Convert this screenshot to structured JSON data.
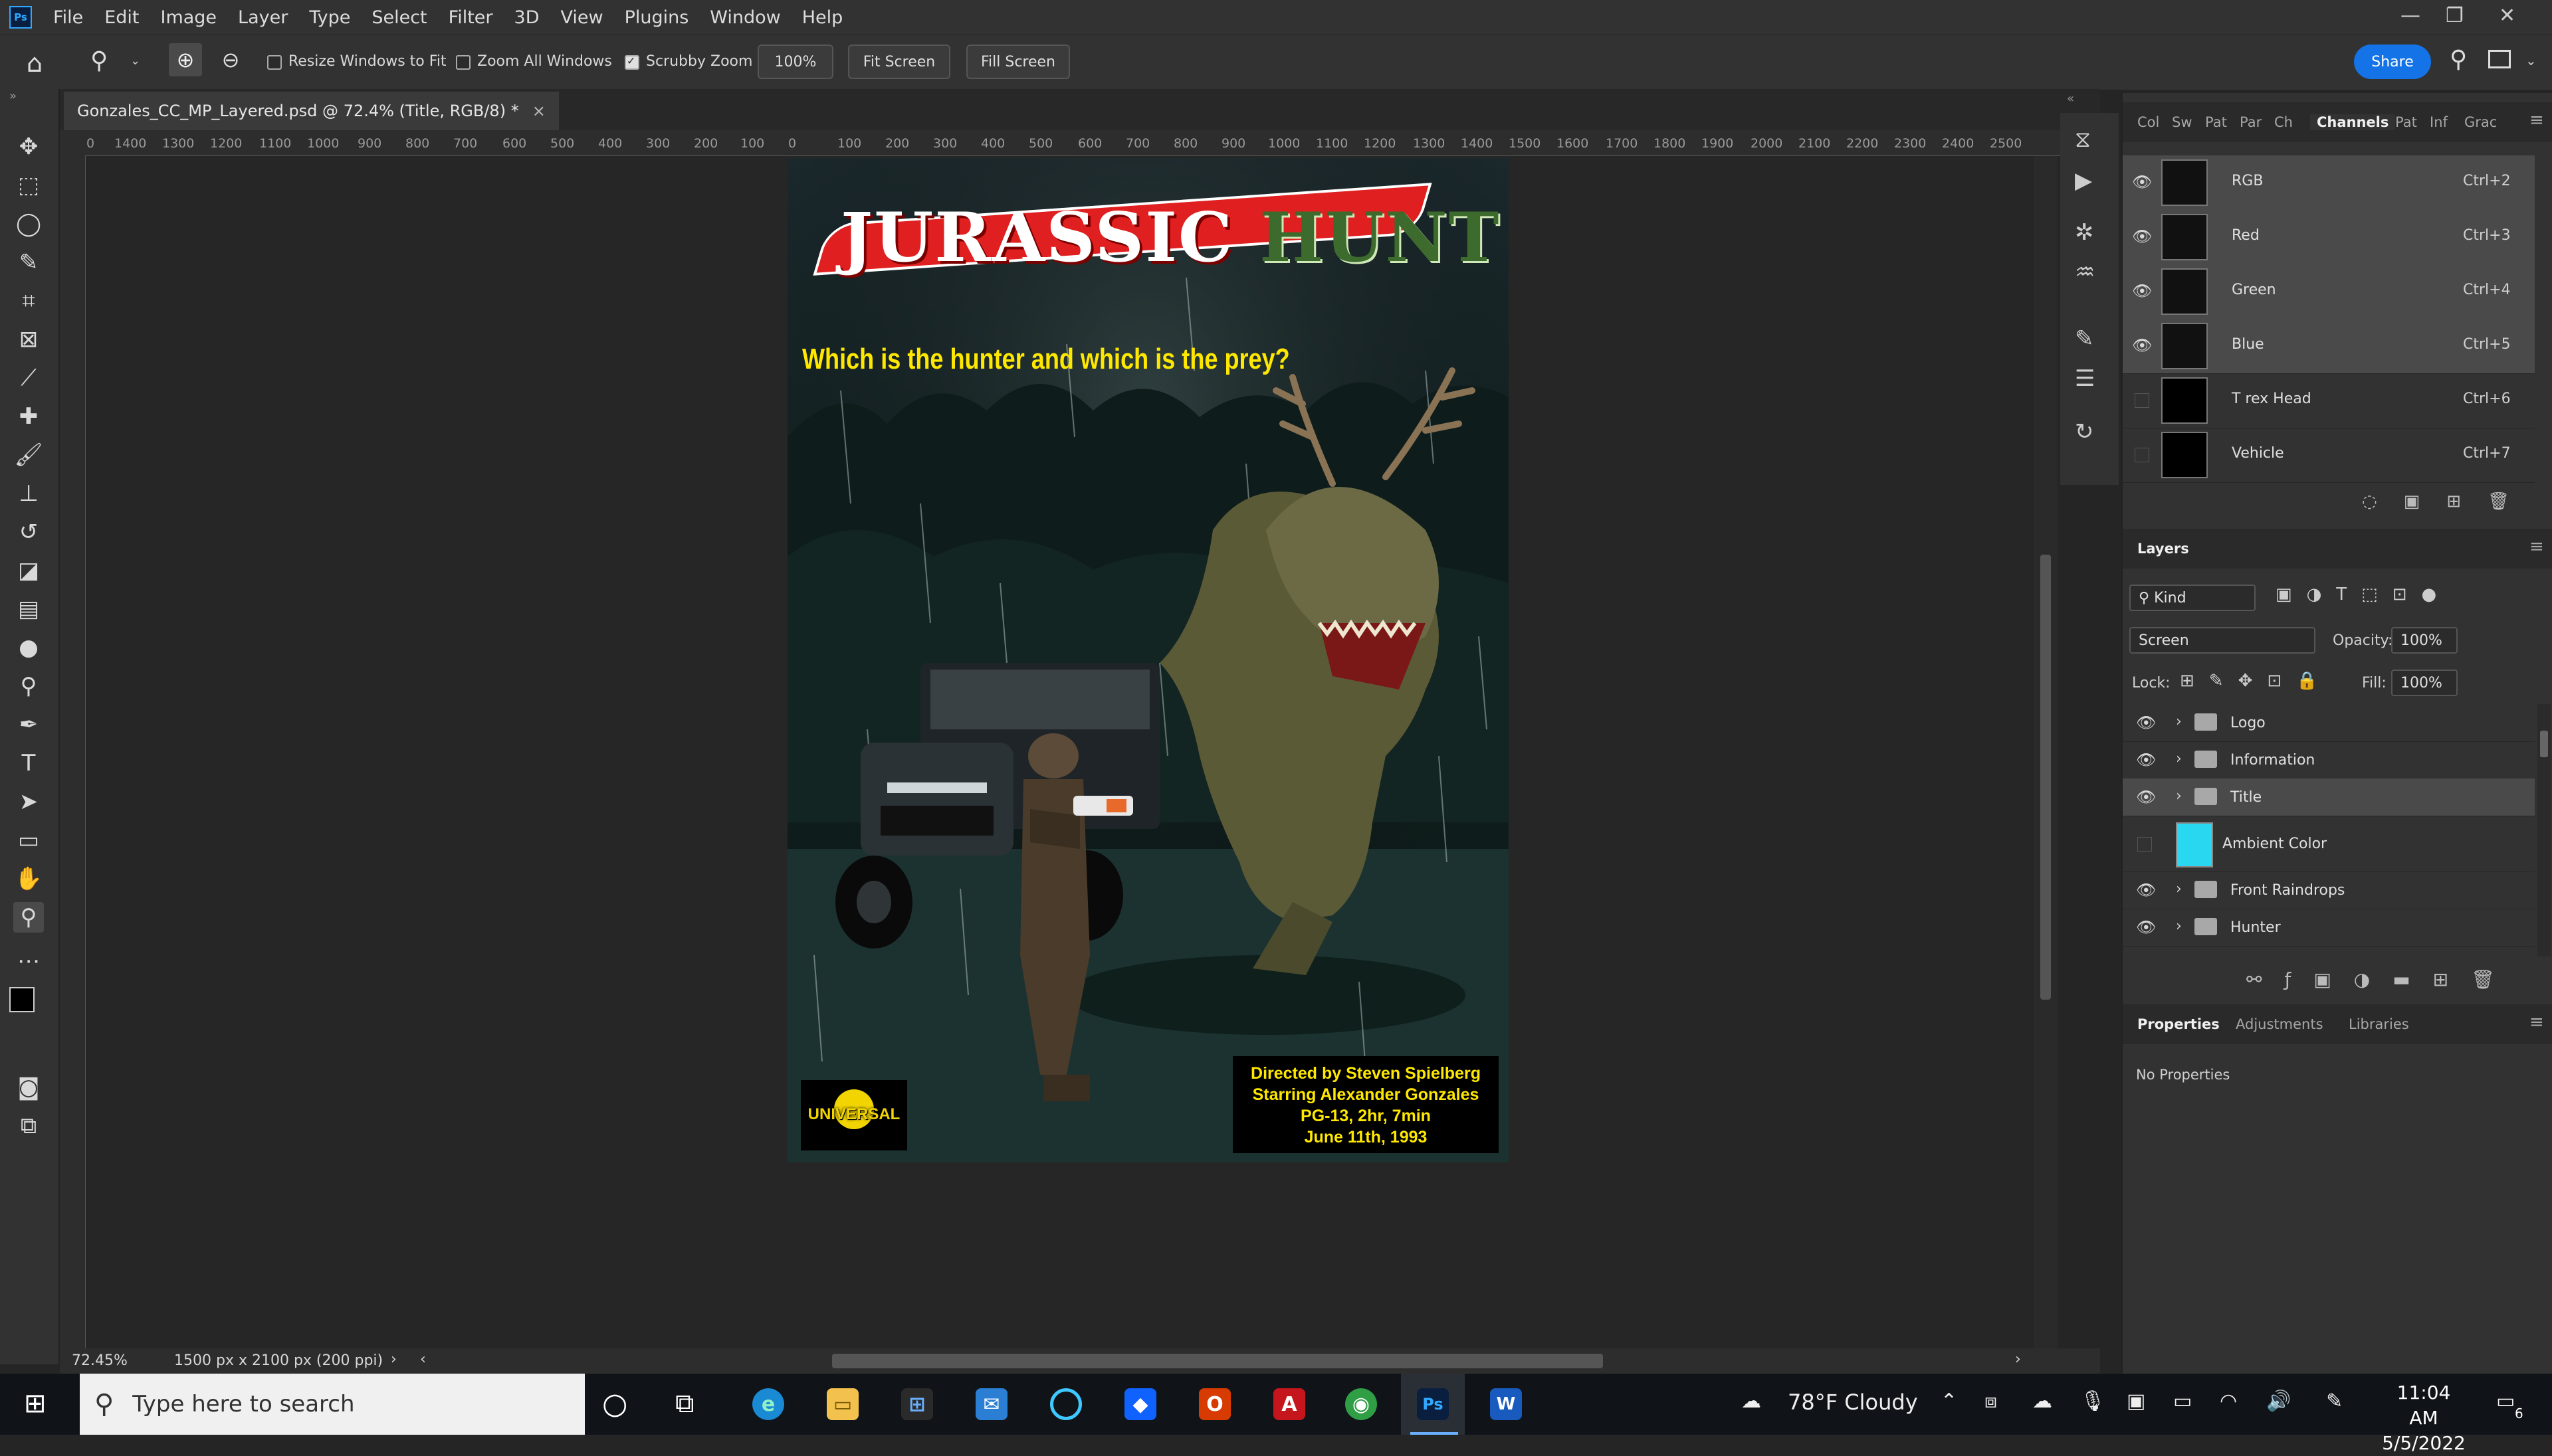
{
  "app": {
    "menu": [
      "File",
      "Edit",
      "Image",
      "Layer",
      "Type",
      "Select",
      "Filter",
      "3D",
      "View",
      "Plugins",
      "Window",
      "Help"
    ],
    "share_label": "Share"
  },
  "options": {
    "resize_windows": "Resize Windows to Fit",
    "zoom_all": "Zoom All Windows",
    "scrubby_zoom": "Scrubby Zoom",
    "zoom_value": "100%",
    "fit_screen": "Fit Screen",
    "fill_screen": "Fill Screen"
  },
  "document": {
    "tab_title": "Gonzales_CC_MP_Layered.psd @ 72.4% (Title, RGB/8) *",
    "ruler_marks": [
      "0",
      "1400",
      "1300",
      "1200",
      "1100",
      "1000",
      "900",
      "800",
      "700",
      "600",
      "500",
      "400",
      "300",
      "200",
      "100",
      "0",
      "100",
      "200",
      "300",
      "400",
      "500",
      "600",
      "700",
      "800",
      "900",
      "1000",
      "1100",
      "1200",
      "1300",
      "1400",
      "1500",
      "1600",
      "1700",
      "1800",
      "1900",
      "2000",
      "2100",
      "2200",
      "2300",
      "2400",
      "2500"
    ],
    "zoom": "72.45%",
    "dimensions": "1500 px x 2100 px (200 ppi)"
  },
  "poster": {
    "title_part1": "JURASSIC",
    "title_part2": "HUNT",
    "tagline": "Which is the hunter and which is the prey?",
    "studio": "UNIVERSAL",
    "credits": [
      "Directed by Steven Spielberg",
      "Starring Alexander Gonzales",
      "PG-13, 2hr, 7min",
      "June 11th, 1993"
    ]
  },
  "channels_panel": {
    "tabs": [
      "Col",
      "Sw",
      "Pat",
      "Par",
      "Ch",
      "Channels",
      "Pat",
      "Inf",
      "Grac"
    ],
    "rows": [
      {
        "name": "RGB",
        "shortcut": "Ctrl+2"
      },
      {
        "name": "Red",
        "shortcut": "Ctrl+3"
      },
      {
        "name": "Green",
        "shortcut": "Ctrl+4"
      },
      {
        "name": "Blue",
        "shortcut": "Ctrl+5"
      },
      {
        "name": "T rex Head",
        "shortcut": "Ctrl+6"
      },
      {
        "name": "Vehicle",
        "shortcut": "Ctrl+7"
      }
    ]
  },
  "layers_panel": {
    "title": "Layers",
    "filter_kind": "Kind",
    "blend_mode": "Screen",
    "opacity_label": "Opacity:",
    "opacity": "100%",
    "lock_label": "Lock:",
    "fill_label": "Fill:",
    "fill": "100%",
    "layers": [
      {
        "name": "Logo",
        "type": "group"
      },
      {
        "name": "Information",
        "type": "group"
      },
      {
        "name": "Title",
        "type": "group"
      },
      {
        "name": "Ambient Color",
        "type": "fill"
      },
      {
        "name": "Front Raindrops",
        "type": "group"
      },
      {
        "name": "Hunter",
        "type": "group"
      }
    ]
  },
  "properties_panel": {
    "tabs": [
      "Properties",
      "Adjustments",
      "Libraries"
    ],
    "content": "No Properties"
  },
  "taskbar": {
    "search_placeholder": "Type here to search",
    "weather": "78°F  Cloudy",
    "time": "11:04 AM",
    "date": "5/5/2022",
    "notifications": "6"
  },
  "colors": {
    "accent": "#1473e6",
    "panel_bg": "#323232",
    "canvas_bg": "#262626",
    "title_red": "#e02020",
    "tagline_yellow": "#ffe800",
    "ambient_swatch": "#29d7f0"
  }
}
